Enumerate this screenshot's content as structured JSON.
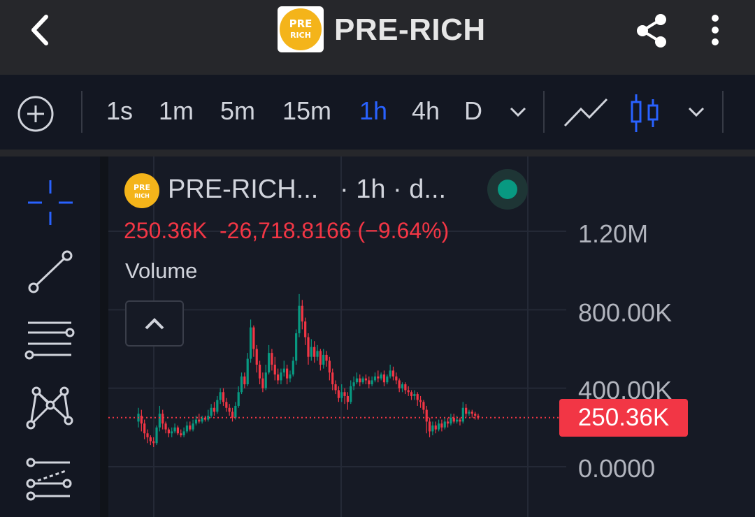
{
  "header": {
    "title": "PRE-RICH",
    "logo_text_top": "PRE",
    "logo_text_bottom": "RICH"
  },
  "toolbar": {
    "intervals": [
      "1s",
      "1m",
      "5m",
      "15m",
      "1h",
      "4h",
      "D"
    ],
    "active_interval": "1h",
    "accent_color": "#2962ff"
  },
  "legend": {
    "symbol": "PRE-RICH...",
    "interval": "· 1h · d...",
    "last": "250.36K",
    "change": "-26,718.8166 (−9.64%)",
    "indicator": "Volume",
    "status_color": "#089981"
  },
  "price_axis": {
    "labels": [
      "1.20M",
      "800.00K",
      "400.00K",
      "0.0000"
    ],
    "current_price_label": "250.36K",
    "current_price_color": "#f23645"
  },
  "icons": {
    "header": [
      "back-arrow-icon",
      "share-icon",
      "more-vertical-icon"
    ],
    "toolbar": [
      "add-circle-icon",
      "chevron-down-icon",
      "line-chart-icon",
      "candlestick-icon"
    ],
    "drawing_tools": [
      "crosshair-icon",
      "trend-line-icon",
      "horizontal-lines-icon",
      "pattern-icon",
      "fib-icon"
    ]
  },
  "chart_data": {
    "type": "candlestick",
    "up_color": "#089981",
    "down_color": "#f23645",
    "ylim": [
      0,
      1200000
    ],
    "last_price": 250360,
    "candles": [
      [
        230000,
        270000,
        300000,
        200000
      ],
      [
        260000,
        220000,
        290000,
        180000
      ],
      [
        220000,
        170000,
        240000,
        140000
      ],
      [
        170000,
        150000,
        190000,
        120000
      ],
      [
        150000,
        130000,
        160000,
        110000
      ],
      [
        130000,
        120000,
        150000,
        100000
      ],
      [
        120000,
        200000,
        210000,
        110000
      ],
      [
        200000,
        270000,
        310000,
        180000
      ],
      [
        270000,
        220000,
        290000,
        190000
      ],
      [
        220000,
        190000,
        230000,
        170000
      ],
      [
        190000,
        170000,
        200000,
        150000
      ],
      [
        170000,
        180000,
        200000,
        150000
      ],
      [
        180000,
        200000,
        220000,
        170000
      ],
      [
        200000,
        170000,
        210000,
        160000
      ],
      [
        170000,
        160000,
        190000,
        150000
      ],
      [
        160000,
        180000,
        200000,
        150000
      ],
      [
        180000,
        210000,
        230000,
        170000
      ],
      [
        210000,
        190000,
        230000,
        180000
      ],
      [
        190000,
        220000,
        240000,
        180000
      ],
      [
        220000,
        240000,
        260000,
        210000
      ],
      [
        240000,
        230000,
        270000,
        220000
      ],
      [
        230000,
        250000,
        260000,
        220000
      ],
      [
        250000,
        240000,
        260000,
        230000
      ],
      [
        240000,
        260000,
        290000,
        230000
      ],
      [
        260000,
        300000,
        320000,
        250000
      ],
      [
        300000,
        280000,
        330000,
        260000
      ],
      [
        280000,
        340000,
        360000,
        270000
      ],
      [
        340000,
        380000,
        400000,
        320000
      ],
      [
        380000,
        330000,
        400000,
        310000
      ],
      [
        330000,
        300000,
        350000,
        280000
      ],
      [
        300000,
        280000,
        320000,
        260000
      ],
      [
        280000,
        250000,
        300000,
        230000
      ],
      [
        250000,
        310000,
        330000,
        240000
      ],
      [
        310000,
        380000,
        410000,
        300000
      ],
      [
        380000,
        460000,
        480000,
        370000
      ],
      [
        460000,
        420000,
        480000,
        400000
      ],
      [
        420000,
        550000,
        580000,
        410000
      ],
      [
        550000,
        710000,
        750000,
        530000
      ],
      [
        710000,
        600000,
        720000,
        560000
      ],
      [
        600000,
        520000,
        620000,
        480000
      ],
      [
        520000,
        450000,
        540000,
        420000
      ],
      [
        450000,
        400000,
        480000,
        380000
      ],
      [
        400000,
        480000,
        520000,
        390000
      ],
      [
        480000,
        580000,
        620000,
        470000
      ],
      [
        580000,
        520000,
        600000,
        490000
      ],
      [
        520000,
        470000,
        560000,
        440000
      ],
      [
        470000,
        440000,
        500000,
        420000
      ],
      [
        440000,
        480000,
        500000,
        420000
      ],
      [
        480000,
        500000,
        540000,
        460000
      ],
      [
        500000,
        450000,
        520000,
        420000
      ],
      [
        450000,
        470000,
        490000,
        430000
      ],
      [
        470000,
        540000,
        560000,
        460000
      ],
      [
        540000,
        680000,
        700000,
        520000
      ],
      [
        680000,
        820000,
        880000,
        660000
      ],
      [
        820000,
        740000,
        850000,
        700000
      ],
      [
        740000,
        660000,
        760000,
        620000
      ],
      [
        660000,
        560000,
        680000,
        520000
      ],
      [
        560000,
        610000,
        650000,
        540000
      ],
      [
        610000,
        560000,
        640000,
        530000
      ],
      [
        560000,
        590000,
        620000,
        540000
      ],
      [
        590000,
        520000,
        600000,
        490000
      ],
      [
        520000,
        570000,
        600000,
        500000
      ],
      [
        570000,
        540000,
        590000,
        510000
      ],
      [
        540000,
        480000,
        560000,
        440000
      ],
      [
        480000,
        420000,
        500000,
        390000
      ],
      [
        420000,
        390000,
        440000,
        370000
      ],
      [
        390000,
        350000,
        410000,
        330000
      ],
      [
        350000,
        380000,
        420000,
        330000
      ],
      [
        380000,
        360000,
        400000,
        320000
      ],
      [
        360000,
        330000,
        380000,
        290000
      ],
      [
        330000,
        410000,
        440000,
        320000
      ],
      [
        410000,
        430000,
        460000,
        390000
      ],
      [
        430000,
        450000,
        480000,
        420000
      ],
      [
        450000,
        430000,
        470000,
        410000
      ],
      [
        430000,
        450000,
        460000,
        420000
      ],
      [
        450000,
        440000,
        470000,
        420000
      ],
      [
        440000,
        420000,
        460000,
        400000
      ],
      [
        420000,
        440000,
        460000,
        410000
      ],
      [
        440000,
        460000,
        480000,
        430000
      ],
      [
        460000,
        450000,
        490000,
        430000
      ],
      [
        450000,
        470000,
        480000,
        440000
      ],
      [
        470000,
        430000,
        490000,
        410000
      ],
      [
        430000,
        460000,
        470000,
        420000
      ],
      [
        460000,
        490000,
        520000,
        450000
      ],
      [
        490000,
        460000,
        510000,
        440000
      ],
      [
        460000,
        440000,
        480000,
        420000
      ],
      [
        440000,
        400000,
        450000,
        380000
      ],
      [
        400000,
        420000,
        430000,
        380000
      ],
      [
        420000,
        390000,
        430000,
        370000
      ],
      [
        390000,
        380000,
        410000,
        360000
      ],
      [
        380000,
        360000,
        390000,
        340000
      ],
      [
        360000,
        370000,
        390000,
        340000
      ],
      [
        370000,
        340000,
        380000,
        310000
      ],
      [
        340000,
        330000,
        360000,
        300000
      ],
      [
        330000,
        290000,
        340000,
        270000
      ],
      [
        290000,
        230000,
        310000,
        170000
      ],
      [
        230000,
        180000,
        250000,
        150000
      ],
      [
        180000,
        210000,
        230000,
        160000
      ],
      [
        210000,
        190000,
        230000,
        170000
      ],
      [
        190000,
        220000,
        240000,
        180000
      ],
      [
        220000,
        200000,
        240000,
        180000
      ],
      [
        200000,
        230000,
        250000,
        190000
      ],
      [
        230000,
        220000,
        250000,
        200000
      ],
      [
        220000,
        250000,
        270000,
        210000
      ],
      [
        250000,
        230000,
        270000,
        220000
      ],
      [
        230000,
        240000,
        260000,
        220000
      ],
      [
        240000,
        230000,
        250000,
        210000
      ],
      [
        230000,
        300000,
        330000,
        220000
      ],
      [
        300000,
        270000,
        320000,
        250000
      ],
      [
        270000,
        280000,
        290000,
        260000
      ],
      [
        280000,
        270000,
        290000,
        250000
      ],
      [
        270000,
        260000,
        280000,
        240000
      ],
      [
        260000,
        250360,
        270000,
        240000
      ]
    ]
  }
}
